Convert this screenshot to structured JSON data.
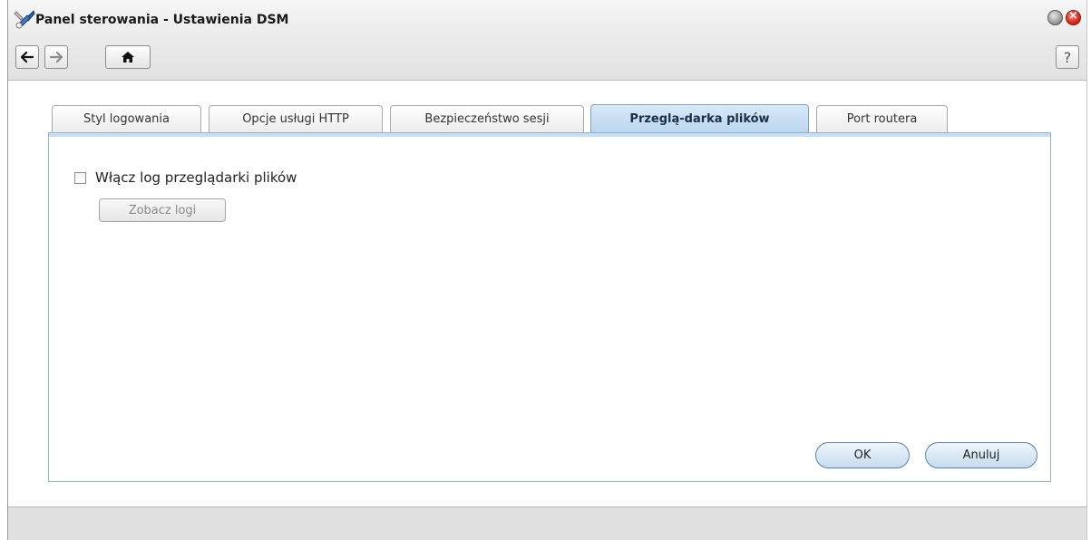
{
  "window": {
    "title": "Panel sterowania - Ustawienia DSM",
    "title_icon": "control-panel-icon",
    "help_label": "?"
  },
  "toolbar": {
    "back_icon": "arrow-left-icon",
    "forward_icon": "arrow-right-icon",
    "home_icon": "home-icon"
  },
  "tabs": [
    {
      "label": "Styl logowania",
      "active": false
    },
    {
      "label": "Opcje usługi HTTP",
      "active": false
    },
    {
      "label": "Bezpieczeństwo sesji",
      "active": false
    },
    {
      "label": "Przeglą-darka plików",
      "active": true
    },
    {
      "label": "Port routera",
      "active": false
    }
  ],
  "panel": {
    "enable_log_label": "Włącz log przeglądarki plików",
    "enable_log_checked": false,
    "view_logs_label": "Zobacz logi"
  },
  "footer": {
    "ok_label": "OK",
    "cancel_label": "Anuluj"
  },
  "colors": {
    "active_tab": "#bad6ee",
    "panel_border": "#8fb3d1",
    "close_button": "#d9261c"
  }
}
